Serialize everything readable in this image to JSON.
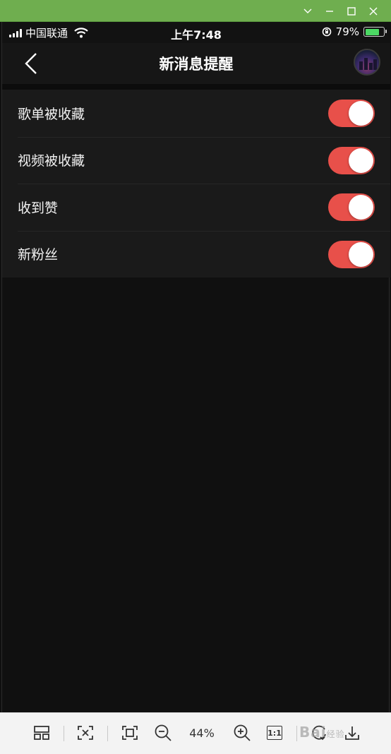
{
  "status_bar": {
    "carrier": "中国联通",
    "time": "上午7:48",
    "battery_percent": "79%",
    "battery_level": 0.79
  },
  "nav": {
    "title": "新消息提醒"
  },
  "settings": [
    {
      "label": "歌单被收藏",
      "enabled": true
    },
    {
      "label": "视频被收藏",
      "enabled": true
    },
    {
      "label": "收到赞",
      "enabled": true
    },
    {
      "label": "新粉丝",
      "enabled": true
    }
  ],
  "toolbar": {
    "zoom": "44%",
    "one_to_one_label": "1:1",
    "watermark": "Bai"
  },
  "colors": {
    "toggle_on": "#e8504a",
    "window_titlebar": "#6fae4f",
    "background": "#0f0f0f",
    "list_background": "#1a1a1a"
  }
}
